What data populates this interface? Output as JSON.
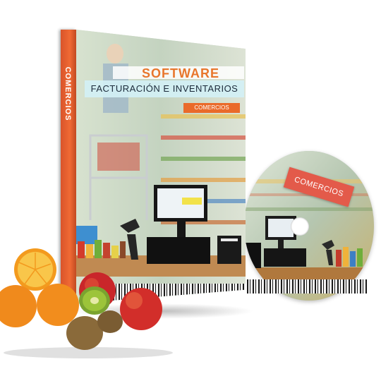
{
  "product": {
    "spine_label": "COMERCIOS",
    "title": "SOFTWARE",
    "subtitle": "FACTURACIÓN E INVENTARIOS",
    "badge": "COMERCIOS",
    "disc_label": "COMERCIOS"
  },
  "colors": {
    "accent_orange": "#ea6a2a",
    "title_orange": "#e8762c",
    "disc_label_red": "#e35a4a"
  },
  "icons": {
    "box": "dvd-box",
    "disc": "cd-disc",
    "terminal": "pos-terminal-icon",
    "scanner": "barcode-scanner-icon",
    "printer": "receipt-printer-icon",
    "fruits": "fruit-group"
  }
}
